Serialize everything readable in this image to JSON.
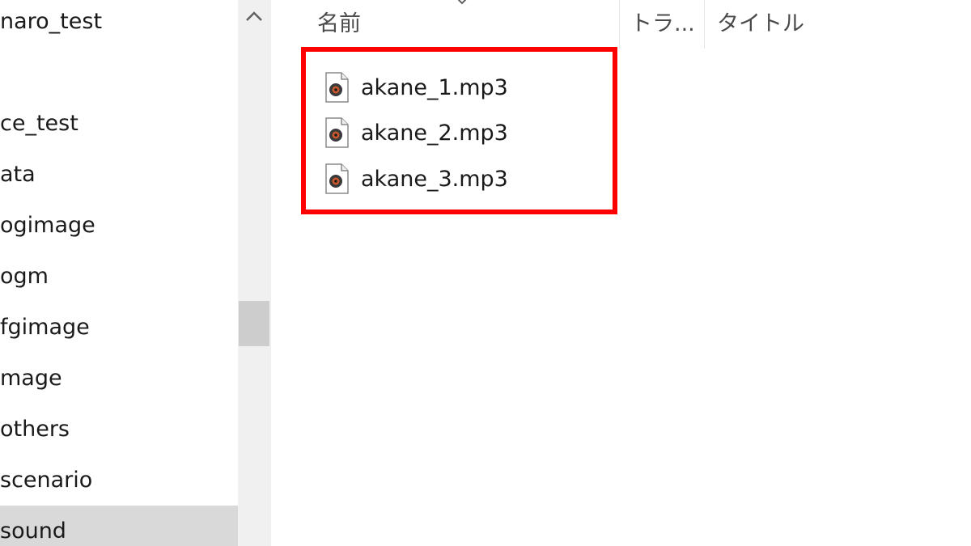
{
  "nav": {
    "items": [
      {
        "label": "naro_test",
        "selected": false
      },
      {
        "label": "ce_test",
        "selected": false
      },
      {
        "label": "ata",
        "selected": false
      },
      {
        "label": "ogimage",
        "selected": false
      },
      {
        "label": "ogm",
        "selected": false
      },
      {
        "label": "fgimage",
        "selected": false
      },
      {
        "label": "mage",
        "selected": false
      },
      {
        "label": "others",
        "selected": false
      },
      {
        "label": "scenario",
        "selected": false
      },
      {
        "label": "sound",
        "selected": true
      }
    ]
  },
  "columns": {
    "name": "名前",
    "track": "トラ...",
    "title": "タイトル"
  },
  "files": [
    {
      "name": "akane_1.mp3",
      "icon": "audio-file-icon"
    },
    {
      "name": "akane_2.mp3",
      "icon": "audio-file-icon"
    },
    {
      "name": "akane_3.mp3",
      "icon": "audio-file-icon"
    }
  ],
  "colors": {
    "highlight": "#ff0000",
    "selection": "#d9d9d9"
  }
}
